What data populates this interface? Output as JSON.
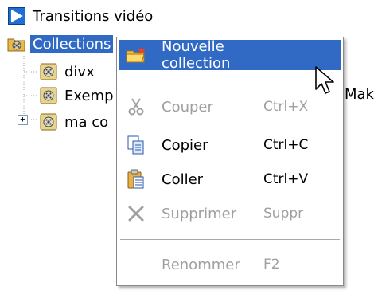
{
  "tree": {
    "items": [
      {
        "label": "Transitions vidéo",
        "icon": "transitions-video-icon"
      },
      {
        "label": "Collections",
        "icon": "collections-folder-icon",
        "selected": true
      },
      {
        "label": "divx",
        "icon": "collection-film-icon"
      },
      {
        "label": "Exemp",
        "icon": "collection-film-icon"
      },
      {
        "label": "ma co",
        "icon": "collection-film-icon"
      }
    ],
    "expander_symbol": "+",
    "hidden_text_fragment": "Make"
  },
  "context_menu": {
    "items": [
      {
        "label": "Nouvelle collection",
        "shortcut": "",
        "icon": "new-collection-folder-icon",
        "state": "highlighted"
      },
      {
        "label": "Couper",
        "shortcut": "Ctrl+X",
        "icon": "scissors-icon",
        "state": "disabled"
      },
      {
        "label": "Copier",
        "shortcut": "Ctrl+C",
        "icon": "copy-icon",
        "state": "enabled"
      },
      {
        "label": "Coller",
        "shortcut": "Ctrl+V",
        "icon": "paste-icon",
        "state": "enabled"
      },
      {
        "label": "Supprimer",
        "shortcut": "Suppr",
        "icon": "delete-x-icon",
        "state": "disabled"
      },
      {
        "label": "Renommer",
        "shortcut": "F2",
        "icon": "",
        "state": "disabled"
      }
    ]
  },
  "colors": {
    "selection": "#316ac5",
    "disabled_text": "#a0a0a0",
    "menu_border": "#8a8a8a"
  }
}
